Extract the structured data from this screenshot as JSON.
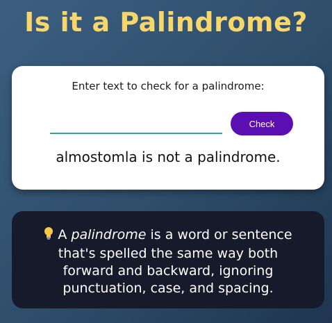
{
  "header": {
    "title": "Is it a Palindrome?"
  },
  "checker": {
    "prompt_label": "Enter text to check for a palindrome:",
    "input_value": "",
    "check_button_label": "Check",
    "result": "almostomla is not a palindrome."
  },
  "info": {
    "icon": "lightbulb-icon",
    "text_before": "A ",
    "emphasis": "palindrome",
    "text_after": " is a word or sentence that's spelled the same way both forward and backward, ignoring punctuation, case, and spacing."
  },
  "colors": {
    "title": "#f7d76b",
    "button": "#5b0fb3",
    "input_underline": "#2aa79b",
    "info_card": "#161a2a"
  }
}
